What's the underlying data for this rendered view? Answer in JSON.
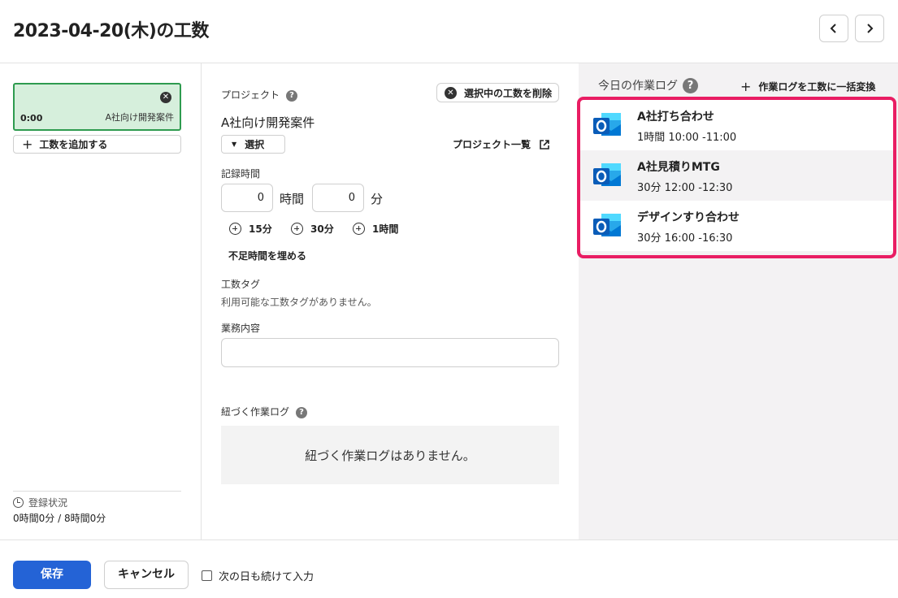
{
  "header": {
    "title": "2023-04-20(木)の工数",
    "prev_icon": "chevron-left-icon",
    "next_icon": "chevron-right-icon"
  },
  "left": {
    "entry": {
      "time": "0:00",
      "project": "A社向け開発案件",
      "close_glyph": "✕"
    },
    "add_button": "工数を追加する",
    "status_label": "登録状況",
    "status_value": "0時間0分 / 8時間0分"
  },
  "form": {
    "project_label": "プロジェクト",
    "help_glyph": "?",
    "delete_button": "選択中の工数を削除",
    "project_name": "A社向け開発案件",
    "select_button": "選択",
    "project_list_link": "プロジェクト一覧",
    "record_time_label": "記録時間",
    "hours_value": "0",
    "hours_unit": "時間",
    "minutes_value": "0",
    "minutes_unit": "分",
    "quick_add": [
      "15分",
      "30分",
      "1時間"
    ],
    "fill_shortage": "不足時間を埋める",
    "tags_label": "工数タグ",
    "tags_empty": "利用可能な工数タグがありません。",
    "work_content_label": "業務内容",
    "work_content_value": "",
    "linked_logs_label": "紐づく作業ログ",
    "linked_logs_empty": "紐づく作業ログはありません。"
  },
  "work_logs": {
    "title": "今日の作業ログ",
    "convert_all": "作業ログを工数に一括変換",
    "items": [
      {
        "name": "A社打ち合わせ",
        "time": "1時間  10:00 -11:00",
        "icon": "outlook-icon"
      },
      {
        "name": "A社見積りMTG",
        "time": "30分  12:00 -12:30",
        "icon": "outlook-icon"
      },
      {
        "name": "デザインすり合わせ",
        "time": "30分  16:00 -16:30",
        "icon": "outlook-icon"
      }
    ],
    "highlight_color": "#e91d63"
  },
  "footer": {
    "save_button": "保存",
    "cancel_button": "キャンセル",
    "next_day_label": "次の日も続けて入力",
    "next_day_checked": false
  },
  "colors": {
    "primary": "#2463d6",
    "entry_bg": "#d6efdc",
    "entry_border": "#2e9b4f",
    "panel_bg": "#f3f2f3"
  }
}
